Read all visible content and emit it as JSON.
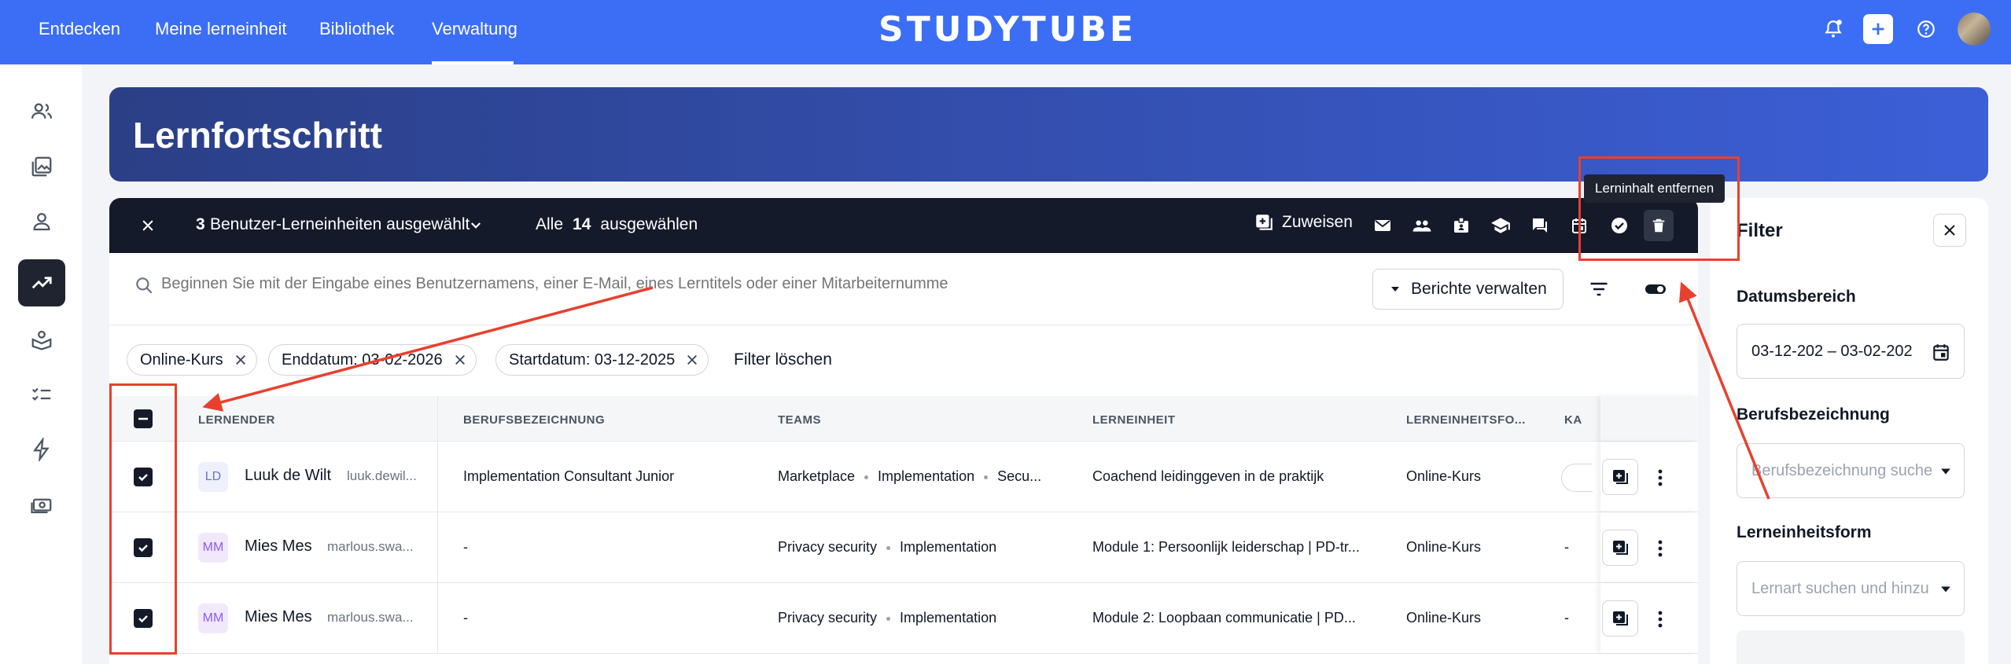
{
  "nav": {
    "items": [
      "Entdecken",
      "Meine lerneinheit",
      "Bibliothek",
      "Verwaltung"
    ],
    "logo": "STUDYTUBE"
  },
  "banner": {
    "title": "Lernfortschritt"
  },
  "selection_bar": {
    "count": "3",
    "label": "Benutzer-Lerneinheiten ausgewählt",
    "select_all_prefix": "Alle",
    "select_all_count": "14",
    "select_all_suffix": "ausgewählen",
    "assign_label": "Zuweisen"
  },
  "tooltip": "Lerninhalt entfernen",
  "search": {
    "placeholder": "Beginnen Sie mit der Eingabe eines Benutzernamens, einer E-Mail, eines Lerntitels oder einer Mitarbeiternummer...",
    "manage_reports": "Berichte verwalten"
  },
  "chips": [
    "Online-Kurs",
    "Enddatum: 03-02-2026",
    "Startdatum: 03-12-2025"
  ],
  "clear_filter": "Filter löschen",
  "columns": [
    "LERNENDER",
    "BERUFSBEZEICHNUNG",
    "TEAMS",
    "LERNEINHEIT",
    "LERNEINHEITSFO...",
    "KA"
  ],
  "rows": [
    {
      "initials": "LD",
      "name": "Luuk de Wilt",
      "email": "luuk.dewil...",
      "job": "Implementation Consultant Junior",
      "teams": [
        "Marketplace",
        "Implementation",
        "Secu..."
      ],
      "unit": "Coachend leidinggeven in de praktijk",
      "form": "Online-Kurs"
    },
    {
      "initials": "MM",
      "name": "Mies Mes",
      "email": "marlous.swa...",
      "job": "-",
      "teams": [
        "Privacy security",
        "Implementation"
      ],
      "unit": "Module 1: Persoonlijk leiderschap | PD-tr...",
      "form": "Online-Kurs",
      "extra": "-"
    },
    {
      "initials": "MM",
      "name": "Mies Mes",
      "email": "marlous.swa...",
      "job": "-",
      "teams": [
        "Privacy security",
        "Implementation"
      ],
      "unit": "Module 2: Loopbaan communicatie | PD...",
      "form": "Online-Kurs",
      "extra": "-"
    }
  ],
  "filter": {
    "title": "Filter",
    "date_label": "Datumsbereich",
    "date_value": "03-12-202 – 03-02-202",
    "job_label": "Berufsbezeichnung",
    "job_placeholder": "Berufsbezeichnung suche",
    "form_label": "Lerneinheitsform",
    "form_placeholder": "Lernart suchen und hinzu"
  },
  "colors": {
    "primary": "#3b6ef5",
    "dark": "#141a2a",
    "annotation": "#e8402e"
  }
}
